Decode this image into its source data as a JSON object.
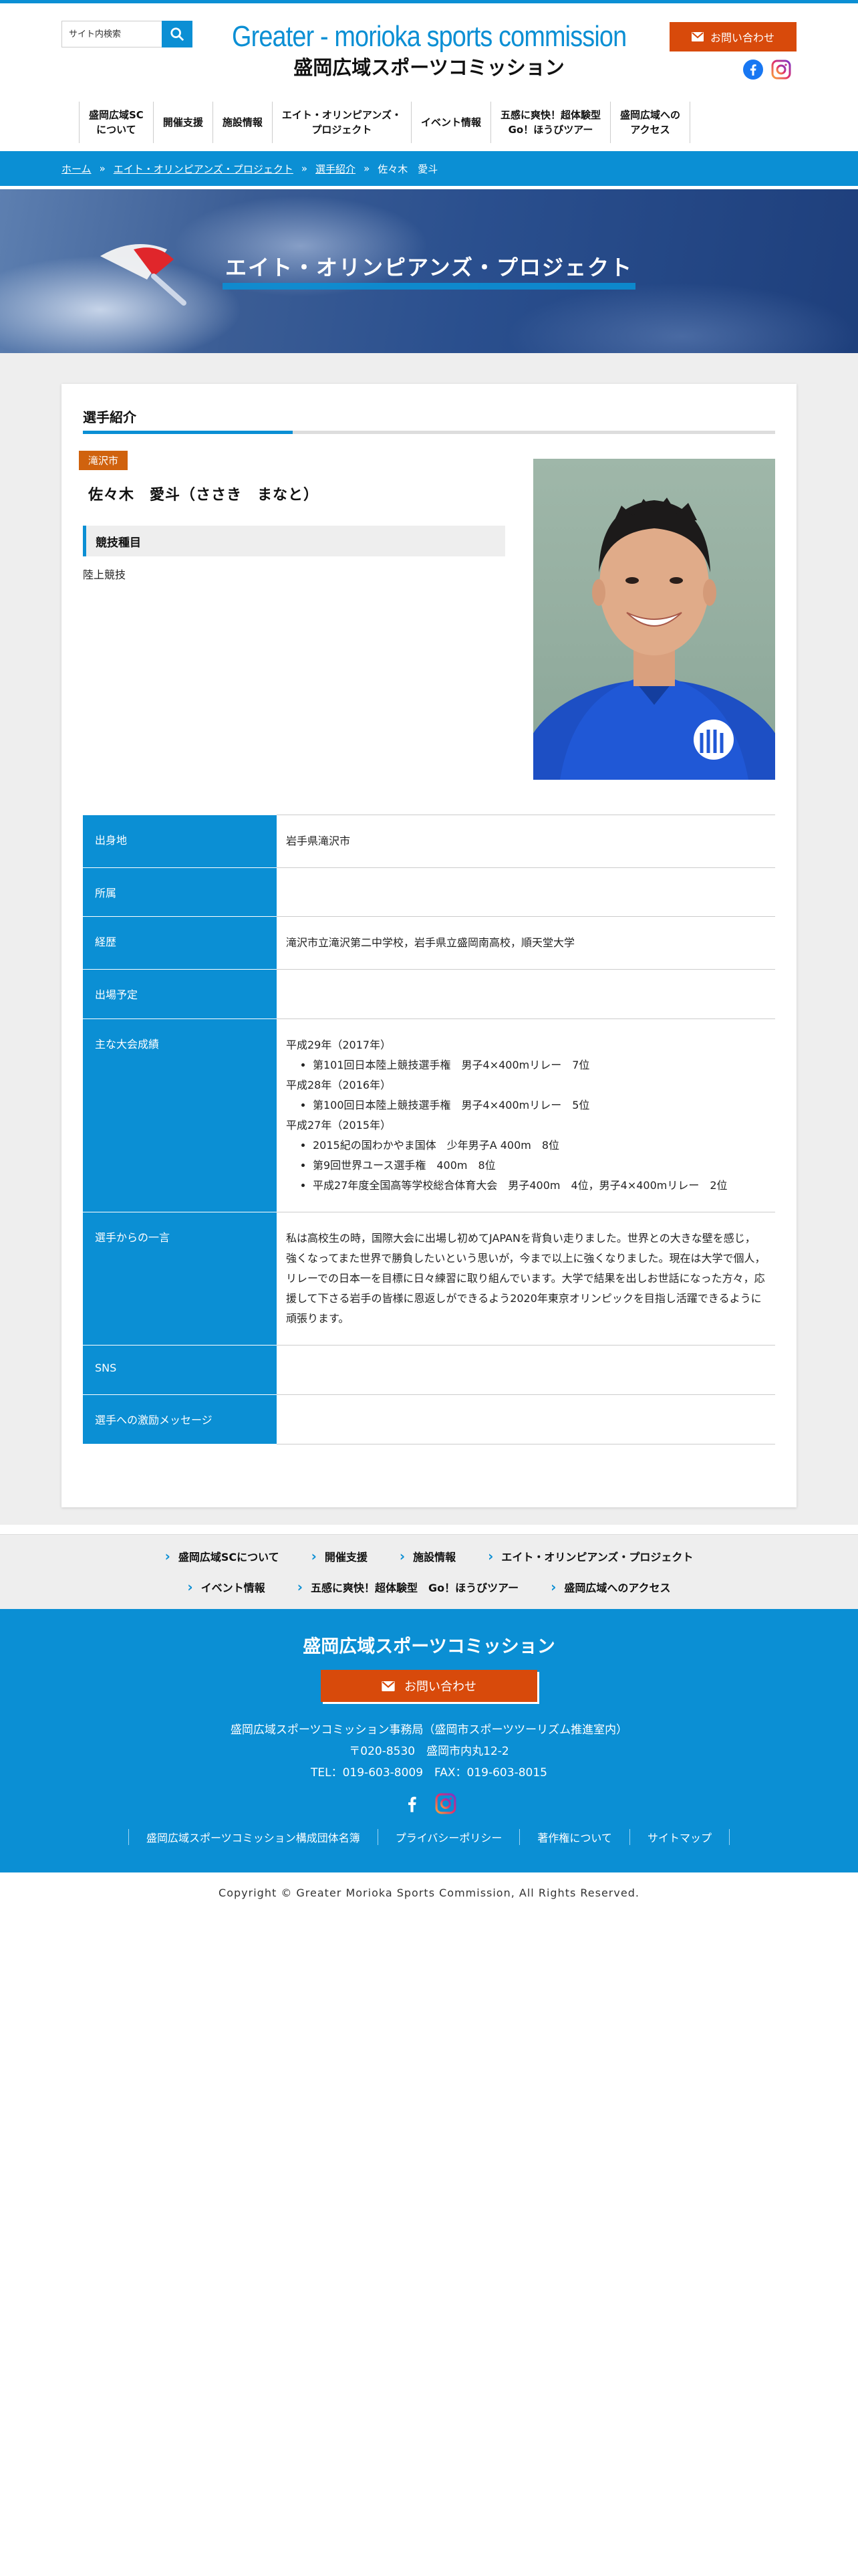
{
  "header": {
    "search_placeholder": "サイト内検索",
    "logo_en": "Greater - morioka sports commission",
    "logo_ja": "盛岡広域スポーツコミッション",
    "contact_label": "お問い合わせ"
  },
  "nav": {
    "items": [
      {
        "label": "盛岡広域SC\nについて"
      },
      {
        "label": "開催支援"
      },
      {
        "label": "施設情報"
      },
      {
        "label": "エイト・オリンピアンズ・\nプロジェクト"
      },
      {
        "label": "イベント情報"
      },
      {
        "label": "五感に爽快！超体験型\nGo！ほうびツアー"
      },
      {
        "label": "盛岡広域への\nアクセス"
      }
    ]
  },
  "breadcrumb": {
    "home": "ホーム",
    "project": "エイト・オリンピアンズ・プロジェクト",
    "athletes": "選手紹介",
    "current": "佐々木　愛斗",
    "sep": "»"
  },
  "hero": {
    "title": "エイト・オリンピアンズ・プロジェクト"
  },
  "profile": {
    "section_title": "選手紹介",
    "city": "滝沢市",
    "name": "佐々木　愛斗（ささき　まなと）",
    "event_heading": "競技種目",
    "event": "陸上競技"
  },
  "table": {
    "birthplace_label": "出身地",
    "birthplace": "岩手県滝沢市",
    "affiliation_label": "所属",
    "affiliation": "",
    "career_label": "経歴",
    "career": "滝沢市立滝沢第二中学校，岩手県立盛岡南高校，順天堂大学",
    "schedule_label": "出場予定",
    "schedule": "",
    "results_label": "主な大会成績",
    "results": {
      "y2017": "平成29年（2017年）",
      "r2017_1": "第101回日本陸上競技選手権　男子4×400mリレー　7位",
      "y2016": "平成28年（2016年）",
      "r2016_1": "第100回日本陸上競技選手権　男子4×400mリレー　5位",
      "y2015": "平成27年（2015年）",
      "r2015_1": "2015紀の国わかやま国体　少年男子A 400m　8位",
      "r2015_2": "第9回世界ユース選手権　400m　8位",
      "r2015_3": "平成27年度全国高等学校総合体育大会　男子400m　4位，男子4×400mリレー　2位"
    },
    "message_label": "選手からの一言",
    "message": "私は高校生の時，国際大会に出場し初めてJAPANを背負い走りました。世界との大きな壁を感じ，強くなってまた世界で勝負したいという思いが，今まで以上に強くなりました。現在は大学で個人，リレーでの日本一を目標に日々練習に取り組んでいます。大学で結果を出しお世話になった方々，応援して下さる岩手の皆様に恩返しができるよう2020年東京オリンピックを目指し活躍できるように頑張ります。",
    "sns_label": "SNS",
    "sns": "",
    "cheer_label": "選手への激励メッセージ",
    "cheer": ""
  },
  "footer_nav": {
    "row1": [
      "盛岡広域SCについて",
      "開催支援",
      "施設情報",
      "エイト・オリンピアンズ・プロジェクト"
    ],
    "row2": [
      "イベント情報",
      "五感に爽快！超体験型　Go！ほうびツアー",
      "盛岡広域へのアクセス"
    ]
  },
  "footer": {
    "name": "盛岡広域スポーツコミッション",
    "contact_label": "お問い合わせ",
    "office": "盛岡広域スポーツコミッション事務局（盛岡市スポーツツーリズム推進室内）",
    "address": "〒020-8530　盛岡市内丸12-2",
    "tel": "TEL：019-603-8009　FAX：019-603-8015",
    "links": [
      "盛岡広域スポーツコミッション構成団体名簿",
      "プライバシーポリシー",
      "著作権について",
      "サイトマップ"
    ],
    "copyright": "Copyright © Greater Morioka Sports Commission, All Rights Reserved."
  },
  "colors": {
    "brand": "#0b8fd4",
    "accent": "#d84a0b",
    "city_tag": "#d0620e"
  }
}
